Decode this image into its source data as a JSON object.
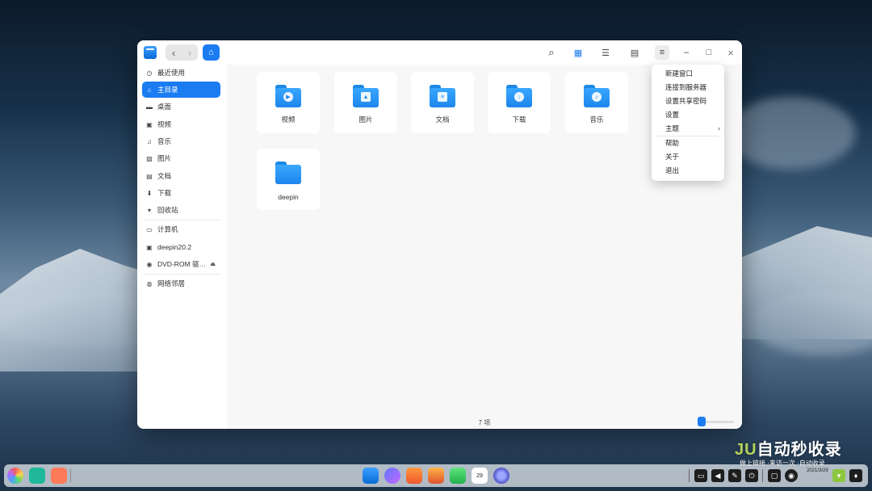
{
  "window": {
    "titlebar": {
      "back_glyph": "‹",
      "forward_glyph": "›",
      "home_glyph": "⌂",
      "search_glyph": "⌕",
      "icon_view_glyph": "▦",
      "list_view_glyph": "☰",
      "detail_view_glyph": "▤",
      "menu_glyph": "≡",
      "minimize_glyph": "–",
      "maximize_glyph": "□",
      "close_glyph": "×"
    },
    "sidebar": {
      "items": [
        {
          "label": "最近使用",
          "icon": "clock-icon",
          "glyph": "◷"
        },
        {
          "label": "主目录",
          "icon": "home-icon",
          "glyph": "⌂",
          "active": true
        },
        {
          "label": "桌面",
          "icon": "desktop-icon",
          "glyph": "▬"
        },
        {
          "label": "视频",
          "icon": "video-icon",
          "glyph": "▣"
        },
        {
          "label": "音乐",
          "icon": "music-icon",
          "glyph": "♫"
        },
        {
          "label": "图片",
          "icon": "picture-icon",
          "glyph": "▨"
        },
        {
          "label": "文档",
          "icon": "document-icon",
          "glyph": "▤"
        },
        {
          "label": "下载",
          "icon": "download-icon",
          "glyph": "⬇"
        },
        {
          "label": "回收站",
          "icon": "trash-icon",
          "glyph": "▾"
        },
        {
          "label": "计算机",
          "icon": "computer-icon",
          "glyph": "▭"
        },
        {
          "label": "deepin20.2",
          "icon": "disk-icon",
          "glyph": "▣"
        },
        {
          "label": "DVD-ROM 驱…",
          "icon": "dvd-icon",
          "glyph": "◉",
          "eject": "⏏"
        },
        {
          "label": "网络邻居",
          "icon": "network-icon",
          "glyph": "◍"
        }
      ]
    },
    "content": {
      "files": [
        {
          "label": "视频",
          "emblem": "▶"
        },
        {
          "label": "图片",
          "emblem": "▲"
        },
        {
          "label": "文档",
          "emblem": "≡"
        },
        {
          "label": "下载",
          "emblem": "↓"
        },
        {
          "label": "音乐",
          "emblem": "♪"
        },
        {
          "label": "deepin",
          "emblem": ""
        }
      ],
      "status": "7 项"
    }
  },
  "menu": {
    "items": [
      {
        "label": "新建窗口"
      },
      {
        "label": "连接到服务器"
      },
      {
        "label": "设置共享密码"
      },
      {
        "label": "设置"
      },
      {
        "label": "主题",
        "submenu": "›"
      },
      {
        "label": "帮助"
      },
      {
        "label": "关于"
      },
      {
        "label": "退出"
      }
    ]
  },
  "taskbar": {
    "calendar_day": "29",
    "clock_date": "2021/3/29"
  },
  "watermark": {
    "title_prefix": "JU",
    "title": "自动秒收录",
    "subtitle": "做上链接 ·来访一次 ·自动收录"
  },
  "colors": {
    "accent": "#1b7cf2",
    "folder": "#2a97f5"
  }
}
